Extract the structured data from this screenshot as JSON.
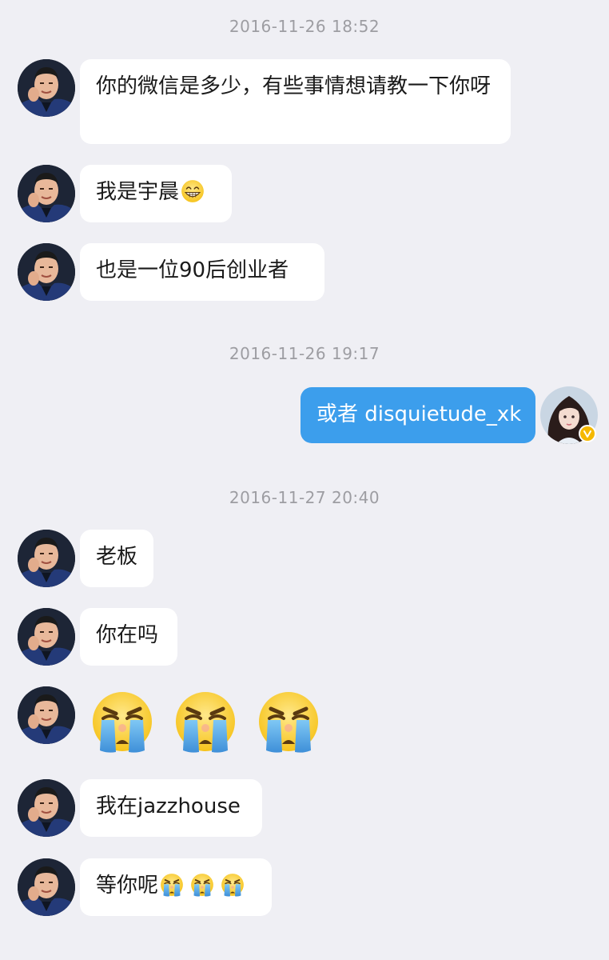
{
  "timestamps": [
    "2016-11-26 18:52",
    "2016-11-26 19:17",
    "2016-11-27 20:40"
  ],
  "messages": {
    "m1": "你的微信是多少，有些事情想请教一下你呀",
    "m2": "我是宇晨",
    "m3": "也是一位90后创业者",
    "m4": "或者 disquietude_xk",
    "m5": "老板",
    "m6": "你在吗",
    "m8": "我在jazzhouse",
    "m9": "等你呢"
  },
  "icons": {
    "grin": "grinning-emoji-icon",
    "cry": "loudly-crying-emoji-icon",
    "verified": "verified-badge-icon"
  },
  "colors": {
    "background": "#efeff4",
    "incoming_bubble": "#ffffff",
    "outgoing_bubble": "#3c9eec",
    "timestamp": "#9d9da2",
    "verified_badge": "#f5b800"
  }
}
